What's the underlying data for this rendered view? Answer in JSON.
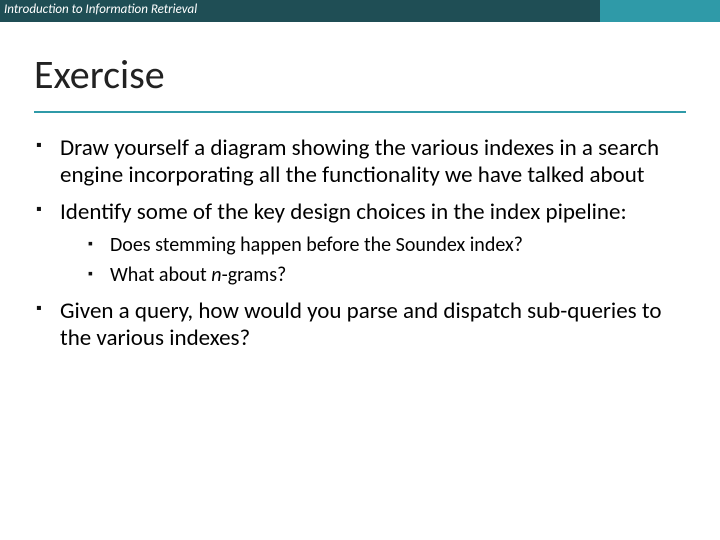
{
  "header": {
    "course": "Introduction to Information Retrieval"
  },
  "title": "Exercise",
  "bullets": {
    "b1": "Draw yourself a diagram showing the various indexes in a search engine incorporating all the functionality we have talked about",
    "b2": "Identify some of the key design choices in the index pipeline:",
    "b2_sub": {
      "s1": "Does stemming happen before the Soundex index?",
      "s2_pre": "What about ",
      "s2_em": "n",
      "s2_post": "-grams?"
    },
    "b3": "Given a query, how would you parse and dispatch sub-queries to the various indexes?"
  }
}
